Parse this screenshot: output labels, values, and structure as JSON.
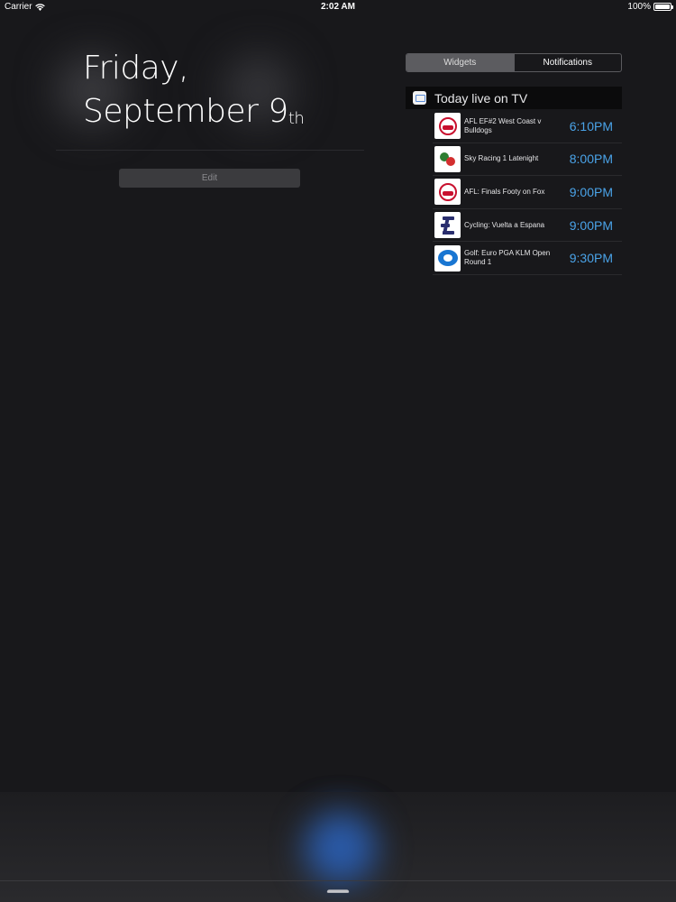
{
  "status_bar": {
    "carrier": "Carrier",
    "time": "2:02 AM",
    "battery_percent": "100%"
  },
  "date": {
    "weekday": "Friday,",
    "month_day": "September 9",
    "suffix": "th"
  },
  "edit_button": {
    "label": "Edit"
  },
  "segmented": {
    "tabs": [
      {
        "label": "Widgets",
        "selected": true
      },
      {
        "label": "Notifications",
        "selected": false
      }
    ]
  },
  "widget": {
    "title": "Today live on TV",
    "items": [
      {
        "title": "AFL EF#2 West Coast v Bulldogs",
        "time": "6:10PM",
        "channel_icon": "fox-footy-icon"
      },
      {
        "title": "Sky Racing 1 Latenight",
        "time": "8:00PM",
        "channel_icon": "sky-racing-icon"
      },
      {
        "title": "AFL: Finals Footy on Fox",
        "time": "9:00PM",
        "channel_icon": "fox-footy-icon"
      },
      {
        "title": "Cycling: Vuelta a Espana",
        "time": "9:00PM",
        "channel_icon": "eurosport-icon"
      },
      {
        "title": "Golf: Euro PGA KLM Open Round 1",
        "time": "9:30PM",
        "channel_icon": "fox-sports-icon"
      }
    ]
  },
  "colors": {
    "accent_time": "#4aa3e8",
    "background": "#18181b"
  }
}
